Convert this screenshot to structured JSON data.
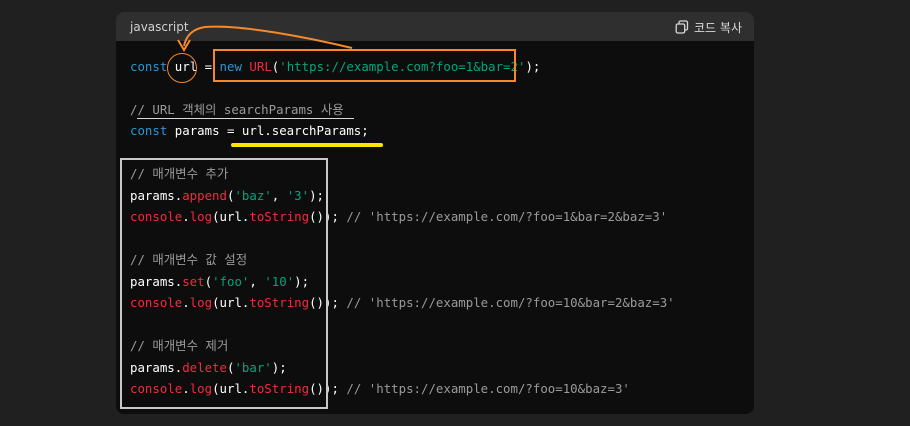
{
  "header": {
    "language": "javascript",
    "copy_label": "코드 복사"
  },
  "code": {
    "l1": {
      "t1": "const",
      "t2": " url",
      "t3": " = ",
      "t4": "new",
      "t5": " ",
      "t6": "URL",
      "t7": "(",
      "t8": "'https://example.com?foo=1&bar=2'",
      "t9": ");"
    },
    "l2": {
      "t1": "// URL 객체의 searchParams 사용"
    },
    "l3": {
      "t1": "const",
      "t2": " params = url.searchParams;"
    },
    "l4": {
      "t1": "// 매개변수 추가"
    },
    "l5": {
      "t1": "params.",
      "t2": "append",
      "t3": "(",
      "t4": "'baz'",
      "t5": ", ",
      "t6": "'3'",
      "t7": ");"
    },
    "l6": {
      "t1": "console",
      "t2": ".",
      "t3": "log",
      "t4": "(url.",
      "t5": "toString",
      "t6": "()); ",
      "t7": "// 'https://example.com/?foo=1&bar=2&baz=3'"
    },
    "l7": {
      "t1": "// 매개변수 값 설정"
    },
    "l8": {
      "t1": "params.",
      "t2": "set",
      "t3": "(",
      "t4": "'foo'",
      "t5": ", ",
      "t6": "'10'",
      "t7": ");"
    },
    "l9": {
      "t1": "console",
      "t2": ".",
      "t3": "log",
      "t4": "(url.",
      "t5": "toString",
      "t6": "()); ",
      "t7": "// 'https://example.com/?foo=10&bar=2&baz=3'"
    },
    "l10": {
      "t1": "// 매개변수 제거"
    },
    "l11": {
      "t1": "params.",
      "t2": "delete",
      "t3": "(",
      "t4": "'bar'",
      "t5": ");"
    },
    "l12": {
      "t1": "console",
      "t2": ".",
      "t3": "log",
      "t4": "(url.",
      "t5": "toString",
      "t6": "()); ",
      "t7": "// 'https://example.com/?foo=10&baz=3'"
    }
  },
  "colors": {
    "keyword": "#2e95d3",
    "function": "#f22c3d",
    "string": "#00a67d",
    "comment": "#9a9a9a",
    "annotation_orange": "#f5882a",
    "annotation_yellow": "#ffe600",
    "annotation_white": "#c9c9c9"
  },
  "icons": {
    "copy": "copy-icon"
  }
}
